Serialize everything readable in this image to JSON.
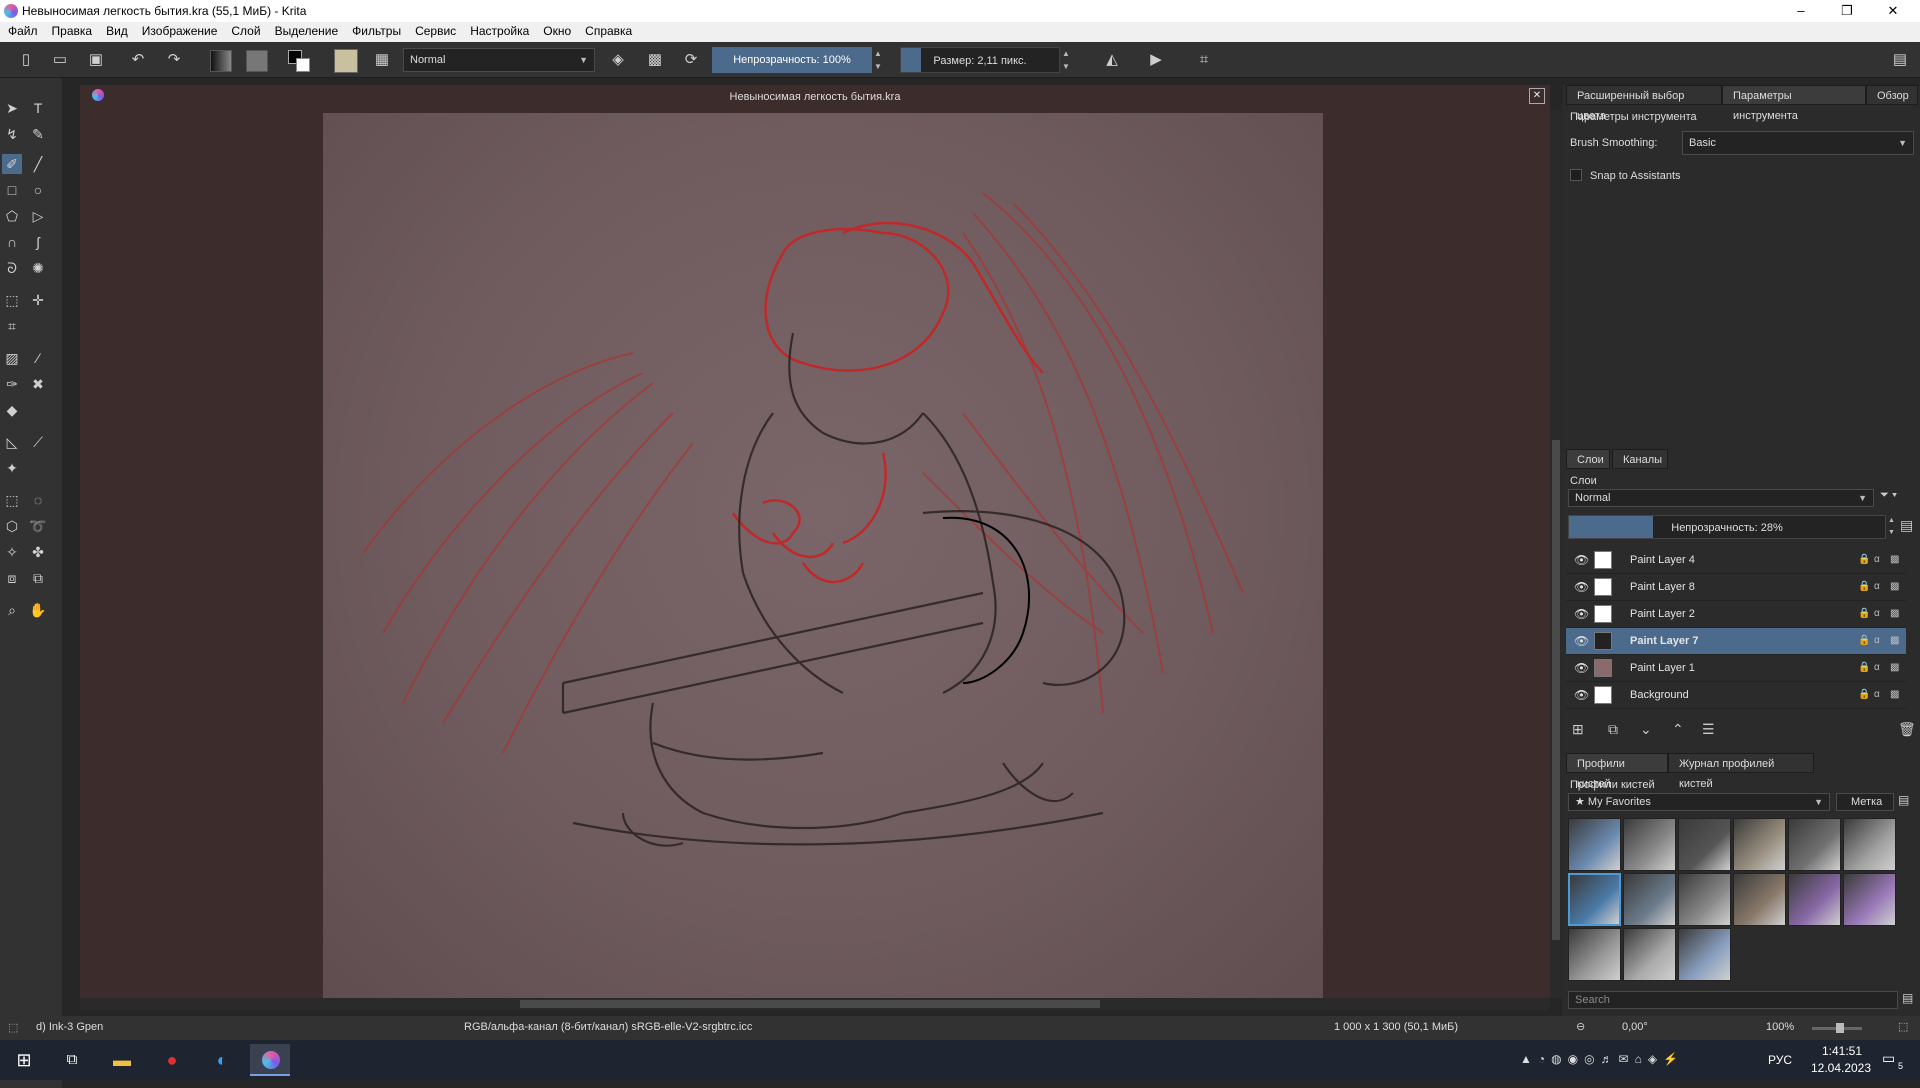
{
  "window": {
    "title": "Невыносимая легкость бытия.kra (55,1 МиБ)  - Krita",
    "minimize": "–",
    "maximize": "❐",
    "close": "✕"
  },
  "menu": [
    "Файл",
    "Правка",
    "Вид",
    "Изображение",
    "Слой",
    "Выделение",
    "Фильтры",
    "Сервис",
    "Настройка",
    "Окно",
    "Справка"
  ],
  "toolbar": {
    "blend_mode": "Normal",
    "opacity": "Непрозрачность: 100%",
    "size": "Размер: 2,11 пикс."
  },
  "document": {
    "title": "Невыносимая легкость бытия.kra"
  },
  "right_tabs": [
    "Расширенный выбор цвета",
    "Параметры инструмента",
    "Обзор"
  ],
  "tool_options": {
    "header": "Параметры инструмента",
    "brush_smoothing_label": "Brush Smoothing:",
    "brush_smoothing_value": "Basic",
    "snap_label": "Snap to Assistants"
  },
  "layers_tabs": [
    "Слои",
    "Каналы"
  ],
  "layers": {
    "header": "Слои",
    "blend_mode": "Normal",
    "opacity": "Непрозрачность:  28%",
    "items": [
      {
        "name": "Paint Layer 4",
        "selected": false
      },
      {
        "name": "Paint Layer 8",
        "selected": false
      },
      {
        "name": "Paint Layer 2",
        "selected": false
      },
      {
        "name": "Paint Layer 7",
        "selected": true
      },
      {
        "name": "Paint Layer 1",
        "selected": false
      },
      {
        "name": "Background",
        "selected": false
      }
    ]
  },
  "brush_tabs": [
    "Профили кистей",
    "Журнал профилей кистей"
  ],
  "brushes": {
    "header": "Профили кистей",
    "tag": "My Favorites",
    "tag_button": "Метка",
    "search_placeholder": "Search",
    "count": 15
  },
  "status": {
    "brush": "d) Ink-3 Gpen",
    "color_space": "RGB/альфа-канал (8-бит/канал)  sRGB-elle-V2-srgbtrc.icc",
    "dimensions": "1 000 x 1 300 (50,1 МиБ)",
    "rotation": "0,00°",
    "zoom": "100%"
  },
  "taskbar": {
    "lang": "РУС",
    "time": "1:41:51",
    "date": "12.04.2023",
    "notif": "5"
  },
  "colors": {
    "accent": "#4c6a8c",
    "sketch_red": "#c0282a",
    "canvas_bg": "#3d2c2c"
  }
}
